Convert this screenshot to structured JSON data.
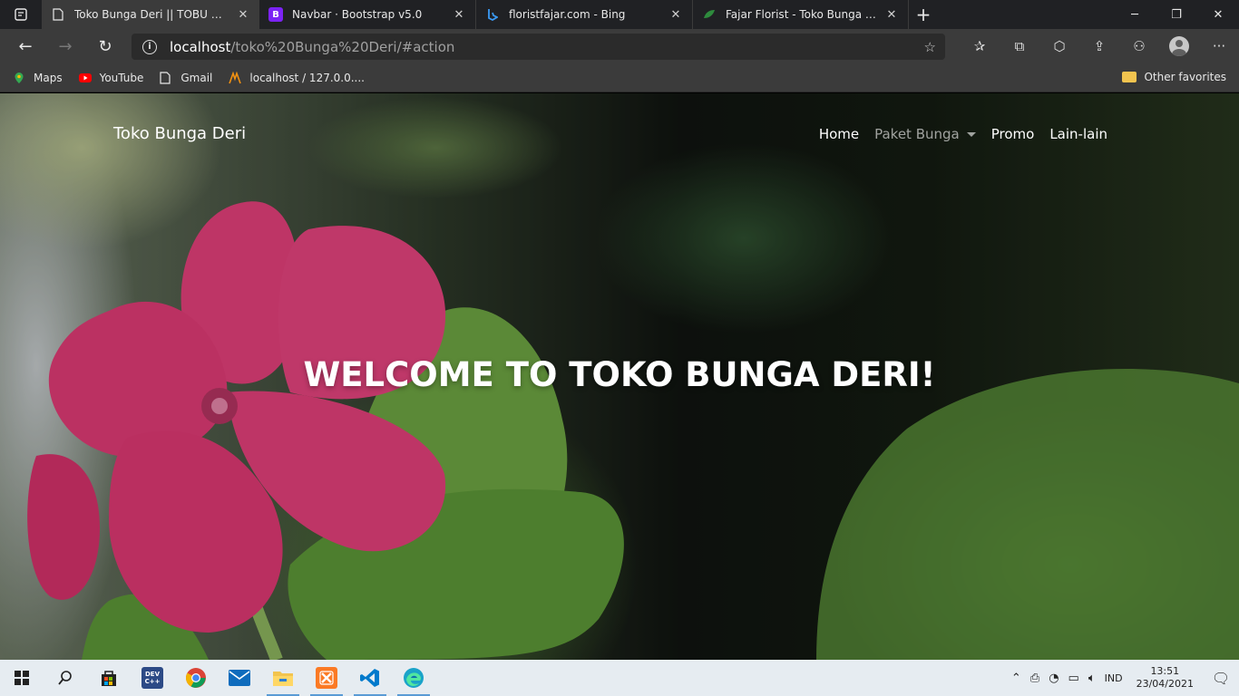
{
  "browser": {
    "tabs": [
      {
        "title": "Toko Bunga Deri || TOBU Deri",
        "active": true,
        "icon": "page-icon"
      },
      {
        "title": "Navbar · Bootstrap v5.0",
        "active": false,
        "icon": "bootstrap-icon"
      },
      {
        "title": "floristfajar.com - Bing",
        "active": false,
        "icon": "bing-icon"
      },
      {
        "title": "Fajar Florist - Toko Bunga Bogor",
        "active": false,
        "icon": "leaf-icon"
      }
    ],
    "url_host": "localhost",
    "url_path": "/toko%20Bunga%20Deri/#action",
    "bookmarks": [
      {
        "label": "Maps",
        "icon": "maps-icon"
      },
      {
        "label": "YouTube",
        "icon": "youtube-icon"
      },
      {
        "label": "Gmail",
        "icon": "page-icon"
      },
      {
        "label": "localhost / 127.0.0....",
        "icon": "phpmyadmin-icon"
      }
    ],
    "other_favorites": "Other favorites"
  },
  "site": {
    "brand": "Toko Bunga Deri",
    "nav": {
      "home": "Home",
      "paket": "Paket Bunga",
      "promo": "Promo",
      "lain": "Lain-lain"
    },
    "headline": "WELCOME TO TOKO BUNGA DERI!"
  },
  "taskbar": {
    "language": "IND",
    "time": "13:51",
    "date": "23/04/2021",
    "apps": [
      "start-icon",
      "search-icon",
      "store-icon",
      "devc-icon",
      "chrome-icon",
      "mail-icon",
      "file-explorer-icon",
      "xampp-icon",
      "vscode-icon",
      "edge-icon"
    ],
    "devc_label": "DEV C++"
  },
  "colors": {
    "flower": "#e8417d",
    "leaf": "#5c9a3a",
    "browser_dark": "#202124",
    "toolbar": "#3b3b3b",
    "taskbar": "#e6ecf1"
  }
}
